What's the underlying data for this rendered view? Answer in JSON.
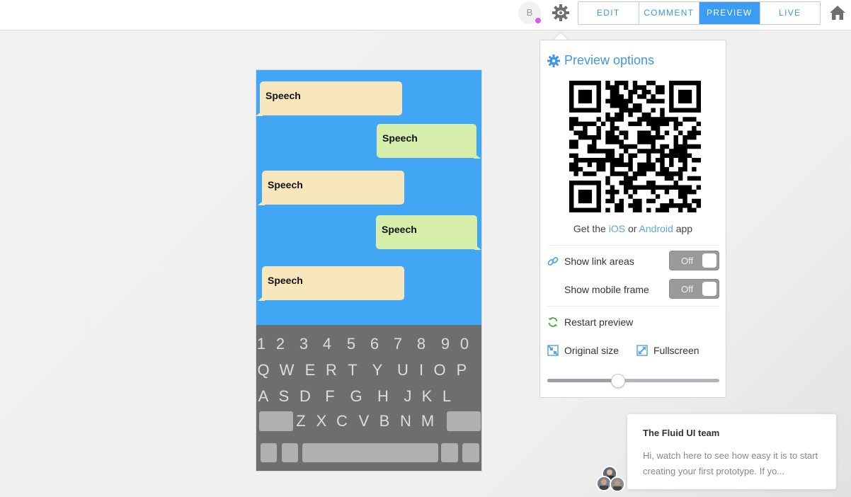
{
  "topbar": {
    "avatar_initial": "B",
    "tabs": [
      {
        "label": "EDIT",
        "active": false
      },
      {
        "label": "COMMENT",
        "active": false
      },
      {
        "label": "PREVIEW",
        "active": true
      },
      {
        "label": "LIVE",
        "active": false
      }
    ],
    "icons": [
      "eye-gear-icon",
      "home-icon"
    ]
  },
  "phone": {
    "bubbles": [
      {
        "text": "Speech",
        "side": "left"
      },
      {
        "text": "Speech",
        "side": "right"
      },
      {
        "text": "Speech",
        "side": "left"
      },
      {
        "text": "Speech",
        "side": "right"
      },
      {
        "text": "Speech",
        "side": "left"
      }
    ],
    "keyboard": {
      "row1": [
        "1",
        "2",
        "3",
        "4",
        "5",
        "6",
        "7",
        "8",
        "9",
        "0"
      ],
      "row2": [
        "Q",
        "W",
        "E",
        "R",
        "T",
        "Y",
        "U",
        "I",
        "O",
        "P"
      ],
      "row3": [
        "A",
        "S",
        "D",
        "F",
        "G",
        "H",
        "J",
        "K",
        "L"
      ],
      "row4": [
        "Z",
        "X",
        "C",
        "V",
        "B",
        "N",
        "M"
      ]
    },
    "colors": {
      "background": "#41a6f3",
      "bubble_left": "#f8e7bd",
      "bubble_right": "#d6eeaa",
      "keyboard": "#6e6e6e"
    }
  },
  "preview_panel": {
    "title": "Preview options",
    "get_app": {
      "prefix": "Get the",
      "ios": "iOS",
      "or": "or",
      "android": "Android",
      "suffix": "app"
    },
    "show_link_areas": {
      "label": "Show link areas",
      "toggle": "Off"
    },
    "show_mobile_frame": {
      "label": "Show mobile frame",
      "toggle": "Off"
    },
    "restart": "Restart preview",
    "original_size": "Original size",
    "fullscreen": "Fullscreen",
    "zoom_fraction": 0.41
  },
  "chat": {
    "title": "The Fluid UI team",
    "message": "Hi, watch here to see how easy it is to start creating your first prototype.   If yo..."
  },
  "accent_color": "#3b9cf2"
}
